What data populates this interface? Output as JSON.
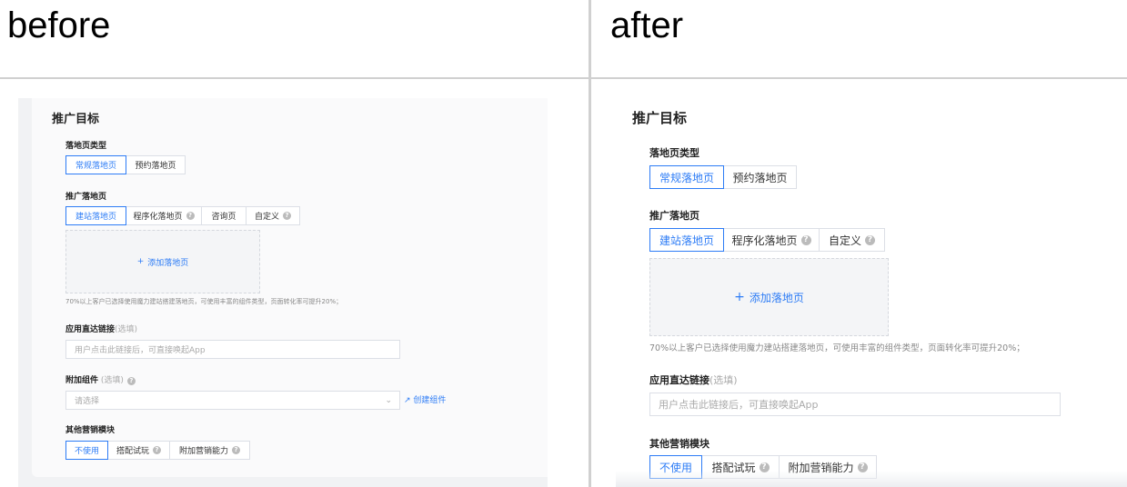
{
  "labels": {
    "before": "before",
    "after": "after"
  },
  "form": {
    "title": "推广目标",
    "landing_type_label": "落地页类型",
    "landing_type_options": [
      "常规落地页",
      "预约落地页"
    ],
    "promo_page_label": "推广落地页",
    "promo_page_options": [
      "建站落地页",
      "程序化落地页",
      "咨询页",
      "自定义"
    ],
    "add_page": "添加落地页",
    "hint": "70%以上客户已选择使用魔力建站搭建落地页，可使用丰富的组件类型，页面转化率可提升20%；",
    "deeplink_label": "应用直达链接",
    "optional": "(选填)",
    "deeplink_placeholder": "用户点击此链接后，可直接唤起App",
    "component_label": "附加组件",
    "component_optional": " (选填)",
    "component_placeholder": "请选择",
    "create_component": "创建组件",
    "marketing_label": "其他营销模块",
    "marketing_options": [
      "不使用",
      "搭配试玩",
      "附加营销能力"
    ],
    "help": "?",
    "plus": "+"
  },
  "colors": {
    "accent": "#2d7cf6"
  }
}
